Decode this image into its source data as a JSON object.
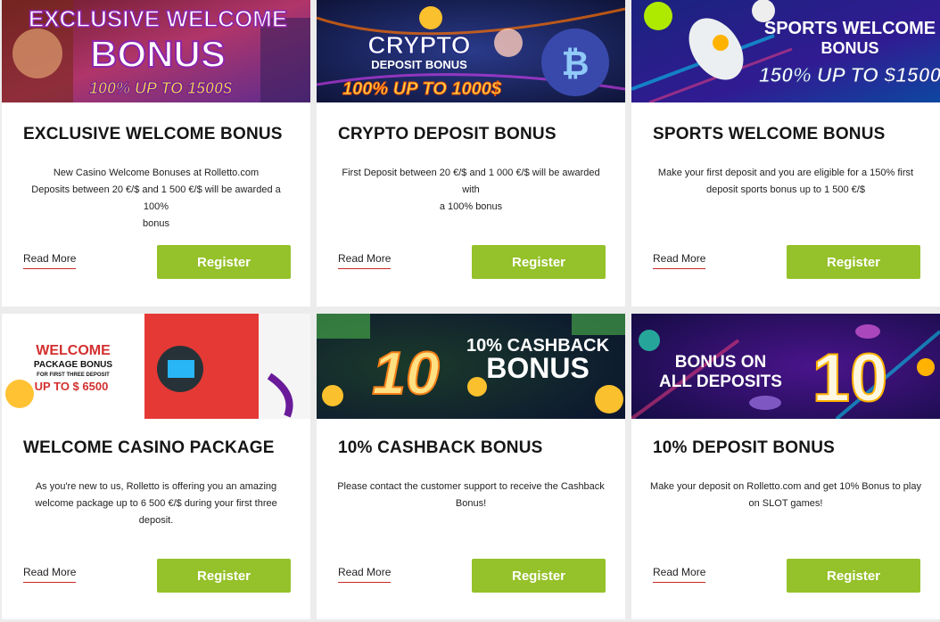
{
  "cards": [
    {
      "title": "EXCLUSIVE WELCOME BONUS",
      "desc_lines": [
        "New Casino Welcome Bonuses at Rolletto.com",
        "Deposits between 20 €/$ and 1 500 €/$ will be awarded a 100%",
        "bonus"
      ],
      "read_more": "Read More",
      "register": "Register",
      "banner": {
        "line1": "EXCLUSIVE WELCOME",
        "line2": "BONUS",
        "line3": "100% UP TO 1500$"
      }
    },
    {
      "title": "CRYPTO DEPOSIT BONUS",
      "desc_lines": [
        "First Deposit between 20 €/$ and 1 000 €/$ will be awarded with",
        "a 100% bonus"
      ],
      "read_more": "Read More",
      "register": "Register",
      "banner": {
        "line1": "CRYPTO",
        "line2": "DEPOSIT BONUS",
        "line3": "100% UP TO 1000$"
      }
    },
    {
      "title": "SPORTS WELCOME BONUS",
      "desc_lines": [
        "Make your first deposit and you are eligible for a 150% first",
        "deposit sports bonus up to 1 500 €/$"
      ],
      "read_more": "Read More",
      "register": "Register",
      "banner": {
        "line1": "SPORTS WELCOME",
        "line2": "BONUS",
        "line3": "150% UP TO $1500"
      }
    },
    {
      "title": "WELCOME CASINO PACKAGE",
      "desc_lines": [
        "As you're new to us, Rolletto is offering you an amazing",
        "welcome package up to 6 500 €/$ during your first three",
        "deposit."
      ],
      "read_more": "Read More",
      "register": "Register",
      "banner": {
        "line1": "WELCOME",
        "line2": "PACKAGE BONUS",
        "line3": "FOR FIRST THREE DEPOSIT",
        "line4": "UP TO $ 6500"
      }
    },
    {
      "title": "10% CASHBACK BONUS",
      "desc_lines": [
        "Please contact the customer support to receive the Cashback",
        "Bonus!"
      ],
      "read_more": "Read More",
      "register": "Register",
      "banner": {
        "line1": "10% CASHBACK",
        "line2": "BONUS",
        "big": "10"
      }
    },
    {
      "title": "10% DEPOSIT BONUS",
      "desc_lines": [
        "Make your deposit on Rolletto.com and get 10% Bonus to play",
        "on SLOT games!"
      ],
      "read_more": "Read More",
      "register": "Register",
      "banner": {
        "line1": "BONUS ON",
        "line2": "ALL DEPOSITS",
        "big": "10"
      }
    }
  ],
  "colors": {
    "register": "#95c12a",
    "read_more_underline": "#c62828",
    "background": "#ececec"
  }
}
